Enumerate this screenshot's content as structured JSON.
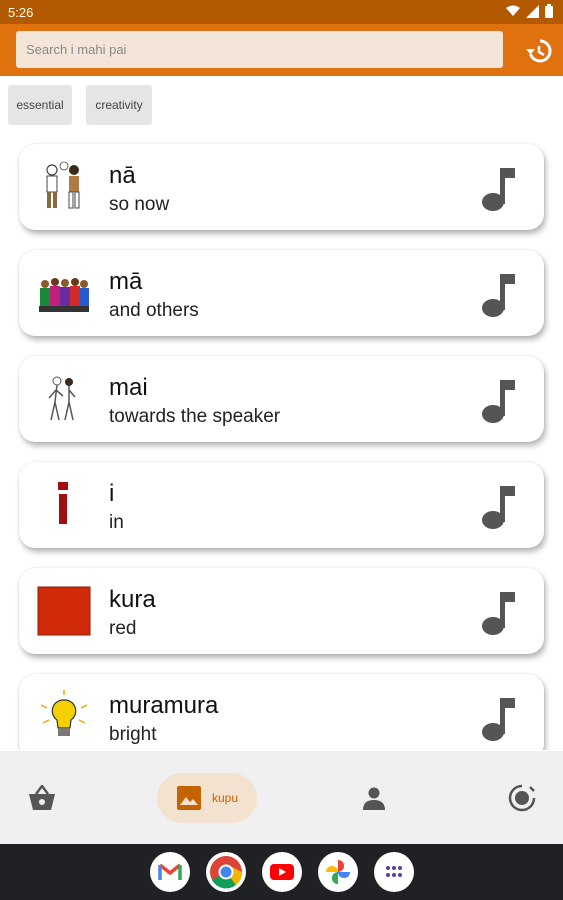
{
  "status": {
    "time": "5:26"
  },
  "search": {
    "placeholder": "Search i mahi pai"
  },
  "chips": [
    {
      "label": "essential"
    },
    {
      "label": "creativity"
    }
  ],
  "words": [
    {
      "word": "nā",
      "translation": "so now"
    },
    {
      "word": "mā",
      "translation": "and others"
    },
    {
      "word": "mai",
      "translation": "towards the speaker"
    },
    {
      "word": "i",
      "translation": "in"
    },
    {
      "word": "kura",
      "translation": "red"
    },
    {
      "word": "muramura",
      "translation": "bright"
    }
  ],
  "nav": {
    "active_label": "kupu"
  },
  "colors": {
    "app_bar": "#e0710f",
    "status_bar": "#b35a00",
    "search_bg": "#f3e6d9",
    "accent_text": "#c46400",
    "kura_red": "#d12a0a",
    "letter_i": "#a01010"
  }
}
